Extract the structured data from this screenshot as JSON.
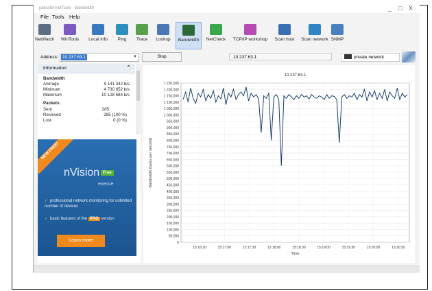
{
  "app": {
    "title": "paessler/netTools - Bandwidth",
    "window_controls": [
      "_",
      "□",
      "X"
    ]
  },
  "menu": [
    "File",
    "Tools",
    "Help"
  ],
  "toolbar": [
    {
      "label": "NetWatch",
      "icon": "netwatch-icon",
      "color": "#5e6e82"
    },
    {
      "label": "WinTools",
      "icon": "wintools-icon",
      "color": "#7a5bbf"
    },
    {
      "label": "Local info",
      "icon": "local-info-icon",
      "color": "#3b78c2"
    },
    {
      "label": "Ping",
      "icon": "ping-icon",
      "color": "#2b8fbf"
    },
    {
      "label": "Trace",
      "icon": "trace-icon",
      "color": "#5aa04a"
    },
    {
      "label": "Lookup",
      "icon": "lookup-icon",
      "color": "#4a78b5"
    },
    {
      "label": "Bandwidth",
      "icon": "bandwidth-icon",
      "color": "#2d6a3a"
    },
    {
      "label": "NetCheck",
      "icon": "netcheck-icon",
      "color": "#3aa84a"
    },
    {
      "label": "TCP/IP workshop",
      "icon": "workshop-icon",
      "color": "#b84ab5"
    },
    {
      "label": "Scan host",
      "icon": "scan-host-icon",
      "color": "#3a6fb5"
    },
    {
      "label": "Scan network",
      "icon": "scan-network-icon",
      "color": "#2f84c6"
    },
    {
      "label": "SNMP",
      "icon": "snmp-icon",
      "color": "#4a7fc0"
    }
  ],
  "address": {
    "label": "Address:",
    "value": "10.237.63.1",
    "stop_label": "Stop",
    "target": "10.237.63.1",
    "network": "private network"
  },
  "info": {
    "title": "Information",
    "bandwidth_heading": "Bandwidth",
    "bandwidth": [
      {
        "label": "Average",
        "value": "9 141 342 b/s"
      },
      {
        "label": "Minimum",
        "value": "4 730 652 b/s"
      },
      {
        "label": "Maximum",
        "value": "10 128 584 b/s"
      }
    ],
    "packets_heading": "Packets:",
    "packets": [
      {
        "label": "Sent",
        "value": "285"
      },
      {
        "label": "Received",
        "value": "285   (100 %)"
      },
      {
        "label": "Lost",
        "value": "0     (0 %)"
      }
    ]
  },
  "ad": {
    "ribbon": "NEW FREE!",
    "brand": "nVision",
    "free_badge": "Free",
    "company": "exence",
    "feature1": "professional network monitoring for unlimited number of devices",
    "feature2_pre": "basic features of the",
    "feature2_pro": "PRO",
    "feature2_post": "version",
    "button": "Learn more"
  },
  "chart_data": {
    "type": "line",
    "title": "10.237.63.1",
    "xlabel": "Time",
    "ylabel": "Bandwidth (bytes per second)",
    "ylim": [
      0,
      1250000
    ],
    "yticks": [
      "0",
      "50,000",
      "100,000",
      "150,000",
      "200,000",
      "250,000",
      "300,000",
      "350,000",
      "400,000",
      "450,000",
      "500,000",
      "550,000",
      "600,000",
      "650,000",
      "700,000",
      "750,000",
      "800,000",
      "850,000",
      "900,000",
      "950,000",
      "1 000,000",
      "1 050,000",
      "1 100,000",
      "1 150,000",
      "1 200,000",
      "1 250,000"
    ],
    "xticks": [
      "15:16:30",
      "15:17:00",
      "15:17:30",
      "15:18:00",
      "15:18:30",
      "15:19:00",
      "15:19:30",
      "15:20:00",
      "15:20:30"
    ],
    "series": [
      {
        "values": [
          1120000,
          1180000,
          1100000,
          1210000,
          1130000,
          1090000,
          1170000,
          1140000,
          1200000,
          1110000,
          1160000,
          1130000,
          1190000,
          1100000,
          1150000,
          1125000,
          1210000,
          1080000,
          1170000,
          1140000,
          1200000,
          1120000,
          1160000,
          1180000,
          1150000,
          1220000,
          1110000,
          1170000,
          1140000,
          1160000,
          1125000,
          860000,
          1150000,
          1130000,
          1170000,
          800000,
          1140000,
          1160000,
          1120000,
          600000,
          1150000,
          1130000,
          1160000,
          1140000,
          1120000,
          1150000,
          1130000,
          1160000,
          1140000,
          1150000,
          1125000,
          1160000,
          1140000,
          1130000,
          1150000,
          1140000,
          1120000,
          1160000,
          1130000,
          1150000,
          1145000,
          1120000,
          780000,
          1140000,
          1160000,
          1130000,
          1150000,
          1140000,
          1170000,
          1120000,
          1160000,
          1140000,
          1200000,
          1110000,
          1180000,
          1140000,
          1190000,
          1120000,
          1170000,
          1130000,
          1200000,
          1110000,
          1180000,
          1150000,
          1130000,
          1210000,
          1120000,
          1170000,
          1140000,
          1160000
        ]
      }
    ]
  }
}
